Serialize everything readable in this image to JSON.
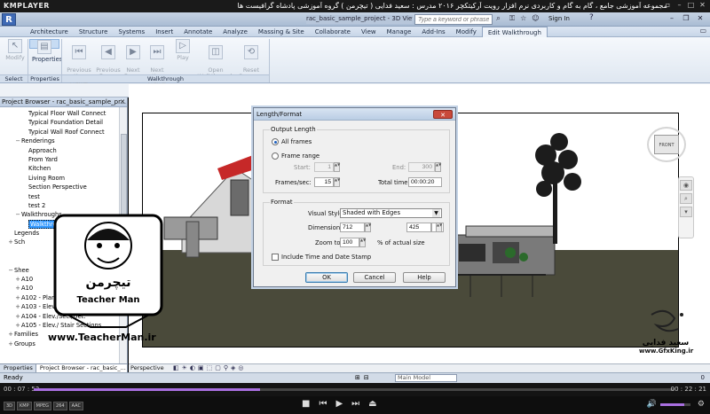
{
  "player": {
    "brand": "KMPLAYER",
    "title": "مجموعه آموزشی جامع ، گام به گام و کاربردی نرم افزار رویت آرکیتکچر ۲۰۱۶   مدرس : سعید فدایی ( تیچرمن ) گروه آموزشی پادشاه گرافیست ها",
    "time_elapsed": "00 : 07 : 52",
    "time_total": "00 : 22 : 21",
    "progress": 0.353,
    "volume": 0.78,
    "badges": [
      "3D",
      "KMP",
      "MPEG",
      "264",
      "AAC"
    ]
  },
  "revit": {
    "app_icon": "R",
    "doc_title": "rac_basic_sample_project - 3D View: Walkthrough 1",
    "search_placeholder": "Type a keyword or phrase",
    "signin": "Sign In",
    "tabs": [
      "Architecture",
      "Structure",
      "Systems",
      "Insert",
      "Annotate",
      "Analyze",
      "Massing & Site",
      "Collaborate",
      "View",
      "Manage",
      "Add-Ins",
      "Modify",
      "Edit Walkthrough"
    ],
    "active_tab": "Edit Walkthrough",
    "ribbon": {
      "modify": "Modify",
      "properties": "Properties",
      "prev_keyframe": "Previous\nKey Frame",
      "prev_frame": "Previous\nFrame",
      "next_frame": "Next\nFrame",
      "next_keyframe": "Next\nKey Frame",
      "play": "Play",
      "open_walkthrough": "Open\nWalkthrough",
      "reset_cameras": "Reset\nCameras",
      "panel_select": "Select",
      "panel_properties": "Properties",
      "panel_walkthrough": "Walkthrough"
    }
  },
  "browser": {
    "title": "Project Browser - rac_basic_sample_pr...",
    "items": [
      {
        "indent": 3,
        "toggle": "",
        "label": "Typical Floor Wall Connect"
      },
      {
        "indent": 3,
        "toggle": "",
        "label": "Typical Foundation Detail"
      },
      {
        "indent": 3,
        "toggle": "",
        "label": "Typical Wall Roof Connect"
      },
      {
        "indent": 2,
        "toggle": "−",
        "label": "Renderings"
      },
      {
        "indent": 3,
        "toggle": "",
        "label": "Approach"
      },
      {
        "indent": 3,
        "toggle": "",
        "label": "From Yard"
      },
      {
        "indent": 3,
        "toggle": "",
        "label": "Kitchen"
      },
      {
        "indent": 3,
        "toggle": "",
        "label": "Living Room"
      },
      {
        "indent": 3,
        "toggle": "",
        "label": "Section Perspective"
      },
      {
        "indent": 3,
        "toggle": "",
        "label": "test"
      },
      {
        "indent": 3,
        "toggle": "",
        "label": "test 2"
      },
      {
        "indent": 2,
        "toggle": "−",
        "label": "Walkthroughs"
      },
      {
        "indent": 3,
        "toggle": "",
        "label": "Walkthrough 1",
        "selected": true
      },
      {
        "indent": 1,
        "toggle": "",
        "label": "Legends"
      },
      {
        "indent": 1,
        "toggle": "+",
        "label": "Sch"
      },
      {
        "indent": 1,
        "toggle": "",
        "label": ""
      },
      {
        "indent": 1,
        "toggle": "",
        "label": ""
      },
      {
        "indent": 1,
        "toggle": "−",
        "label": "Shee"
      },
      {
        "indent": 2,
        "toggle": "+",
        "label": "A10"
      },
      {
        "indent": 2,
        "toggle": "+",
        "label": "A10"
      },
      {
        "indent": 2,
        "toggle": "+",
        "label": "A102 - Plans"
      },
      {
        "indent": 2,
        "toggle": "+",
        "label": "A103 - Elevations/Sections"
      },
      {
        "indent": 2,
        "toggle": "+",
        "label": "A104 - Elev./Sec./Det."
      },
      {
        "indent": 2,
        "toggle": "+",
        "label": "A105 - Elev./ Stair Sections"
      },
      {
        "indent": 1,
        "toggle": "+",
        "label": "Families"
      },
      {
        "indent": 1,
        "toggle": "+",
        "label": "Groups"
      }
    ],
    "bottom_tabs": [
      "Properties",
      "Project Browser - rac_basic_..."
    ]
  },
  "viewport": {
    "view_cube_label": "FRONT",
    "view_mode": "Perspective",
    "ground_color": "#4a4a3a"
  },
  "status": {
    "ready": "Ready",
    "model": "Main Model",
    "filter": "0"
  },
  "dialog": {
    "title": "Length/Format",
    "output_length": "Output Length",
    "all_frames": "All frames",
    "frame_range": "Frame range",
    "start_label": "Start:",
    "start_value": "1",
    "end_label": "End:",
    "end_value": "300",
    "fps_label": "Frames/sec:",
    "fps_value": "15",
    "total_time_label": "Total time:",
    "total_time_value": "00:00:20",
    "format": "Format",
    "visual_style_label": "Visual Style",
    "visual_style_value": "Shaded with Edges",
    "dimensions_label": "Dimensions",
    "dim_w": "712",
    "dim_h": "425",
    "zoom_label": "Zoom to",
    "zoom_value": "100",
    "zoom_suffix": "% of actual size",
    "include_time": "Include Time and Date Stamp",
    "ok": "OK",
    "cancel": "Cancel",
    "help": "Help"
  },
  "watermarks": {
    "left_logo_text": "تیچرمن",
    "left_brand": "Teacher Man",
    "left_url": "www.TeacherMan.ir",
    "right_logo_text": "سعید فدایی",
    "right_url": "www.GfxKing.ir"
  }
}
